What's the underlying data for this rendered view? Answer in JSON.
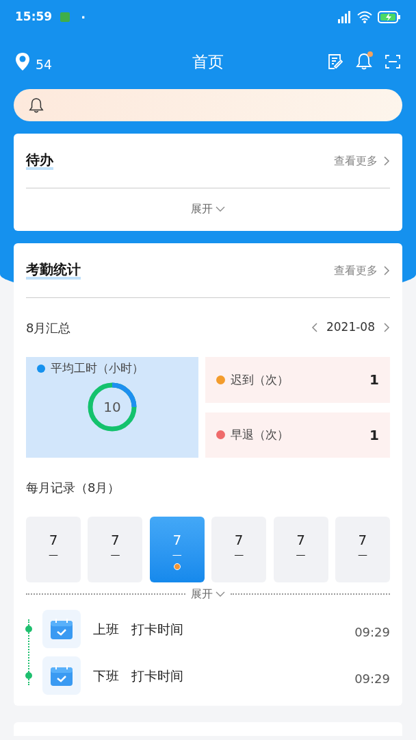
{
  "status_bar": {
    "time": "15:59",
    "dot": "·"
  },
  "header": {
    "location_count": "54",
    "title": "首页",
    "notification_unread": true
  },
  "todo": {
    "title": "待办",
    "more": "查看更多",
    "expand": "展开"
  },
  "attendance": {
    "title": "考勤统计",
    "more": "查看更多",
    "summary_title": "8月汇总",
    "month": "2021-08",
    "avg_hours": {
      "label": "平均工时（小时）",
      "value": "10"
    },
    "stats": [
      {
        "label": "迟到（次）",
        "value": "1",
        "color": "#f39c2c"
      },
      {
        "label": "早退（次）",
        "value": "1",
        "color": "#ef6b6b"
      }
    ],
    "monthly_title": "每月记录（8月）",
    "days": [
      {
        "day": "7",
        "dash": "—",
        "selected": false,
        "marked": false
      },
      {
        "day": "7",
        "dash": "—",
        "selected": false,
        "marked": false
      },
      {
        "day": "7",
        "dash": "—",
        "selected": true,
        "marked": true
      },
      {
        "day": "7",
        "dash": "—",
        "selected": false,
        "marked": false
      },
      {
        "day": "7",
        "dash": "—",
        "selected": false,
        "marked": false
      },
      {
        "day": "7",
        "dash": "—",
        "selected": false,
        "marked": false
      }
    ],
    "expand": "展开",
    "records": [
      {
        "type": "上班",
        "label": "打卡时间",
        "time": "09:29"
      },
      {
        "type": "下班",
        "label": "打卡时间",
        "time": "09:29"
      }
    ]
  }
}
